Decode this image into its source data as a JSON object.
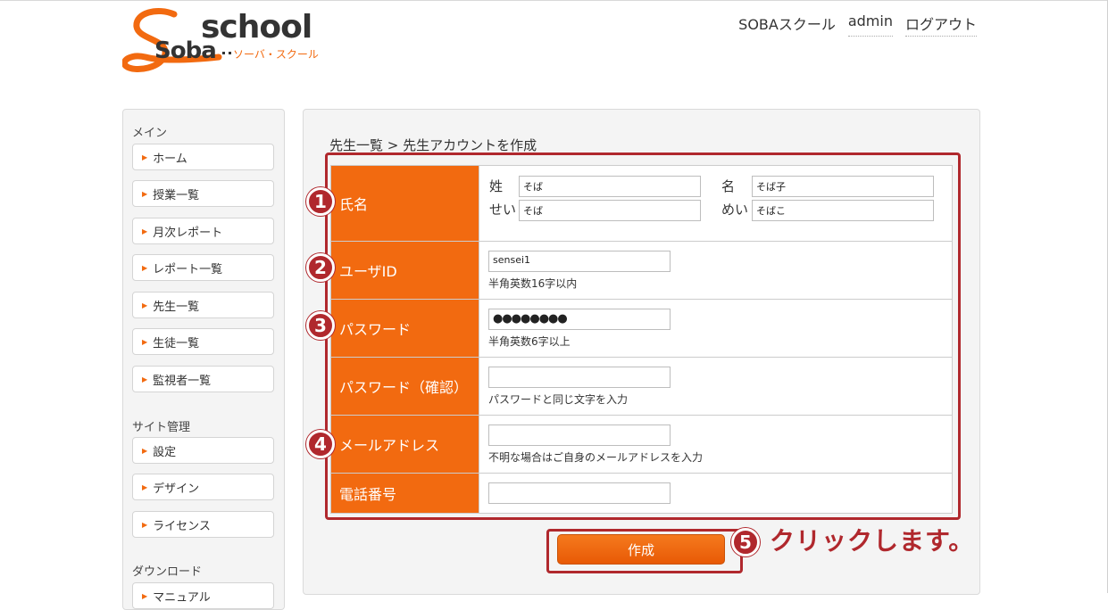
{
  "logo": {
    "word_school": "school",
    "word_soba": "Soba",
    "kana": "ソーバ・スクール"
  },
  "header_nav": {
    "site_link": "SOBAスクール",
    "user": "admin",
    "logout": "ログアウト"
  },
  "sidebar": {
    "section_main": "メイン",
    "main_items": [
      {
        "label": "ホーム"
      },
      {
        "label": "授業一覧"
      },
      {
        "label": "月次レポート"
      },
      {
        "label": "レポート一覧"
      },
      {
        "label": "先生一覧"
      },
      {
        "label": "生徒一覧"
      },
      {
        "label": "監視者一覧"
      }
    ],
    "section_site": "サイト管理",
    "site_items": [
      {
        "label": "設定"
      },
      {
        "label": "デザイン"
      },
      {
        "label": "ライセンス"
      }
    ],
    "section_download": "ダウンロード",
    "download_items": [
      {
        "label": "マニュアル"
      }
    ]
  },
  "main": {
    "breadcrumb": "先生一覧 > 先生アカウントを作成",
    "form": {
      "name": {
        "label": "氏名",
        "sei_label": "姓",
        "sei_value": "そば",
        "mei_label": "名",
        "mei_value": "そば子",
        "sei_kana_label": "せい",
        "sei_kana_value": "そば",
        "mei_kana_label": "めい",
        "mei_kana_value": "そばこ"
      },
      "userid": {
        "label": "ユーザID",
        "value": "sensei1",
        "hint": "半角英数16字以内"
      },
      "password": {
        "label": "パスワード",
        "value": "●●●●●●●●",
        "hint": "半角英数6字以上"
      },
      "password_confirm": {
        "label": "パスワード（確認）",
        "value": "",
        "hint": "パスワードと同じ文字を入力"
      },
      "email": {
        "label": "メールアドレス",
        "value": "",
        "hint": "不明な場合はご自身のメールアドレスを入力"
      },
      "phone": {
        "label": "電話番号",
        "value": ""
      }
    },
    "submit_label": "作成"
  },
  "annotations": {
    "badges": [
      "1",
      "2",
      "3",
      "4",
      "5"
    ],
    "click_text": "クリックします。",
    "color": "#b0282d"
  },
  "colors": {
    "accent": "#f26a10",
    "annotation": "#b0282d"
  }
}
